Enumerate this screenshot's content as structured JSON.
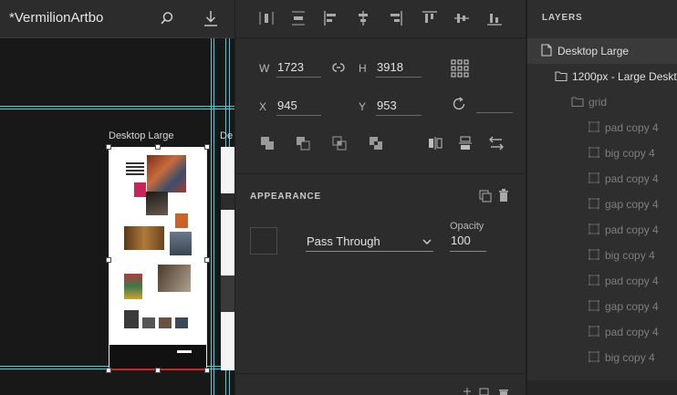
{
  "document": {
    "title": "*VermilionArtbo"
  },
  "canvas": {
    "artboard_label": "Desktop Large",
    "artboard_label_2": "De"
  },
  "transform": {
    "w_label": "W",
    "w_value": "1723",
    "h_label": "H",
    "h_value": "3918",
    "x_label": "X",
    "x_value": "945",
    "y_label": "Y",
    "y_value": "953",
    "rotation_value": ""
  },
  "appearance": {
    "title": "APPEARANCE",
    "blend_mode": "Pass Through",
    "opacity_label": "Opacity",
    "opacity_value": "100"
  },
  "layers": {
    "title": "LAYERS",
    "items": [
      {
        "label": "Desktop Large",
        "depth": 0,
        "kind": "artboard",
        "selected": true
      },
      {
        "label": "1200px - Large Desktop",
        "depth": 1,
        "kind": "group"
      },
      {
        "label": "grid",
        "depth": 2,
        "kind": "group",
        "dim": true
      },
      {
        "label": "pad copy 4",
        "depth": 3,
        "kind": "rect",
        "dim": true
      },
      {
        "label": "big copy 4",
        "depth": 3,
        "kind": "rect",
        "dim": true
      },
      {
        "label": "pad copy 4",
        "depth": 3,
        "kind": "rect",
        "dim": true
      },
      {
        "label": "gap copy 4",
        "depth": 3,
        "kind": "rect",
        "dim": true
      },
      {
        "label": "pad copy 4",
        "depth": 3,
        "kind": "rect",
        "dim": true
      },
      {
        "label": "big copy 4",
        "depth": 3,
        "kind": "rect",
        "dim": true
      },
      {
        "label": "pad copy 4",
        "depth": 3,
        "kind": "rect",
        "dim": true
      },
      {
        "label": "gap copy 4",
        "depth": 3,
        "kind": "rect",
        "dim": true
      },
      {
        "label": "pad copy 4",
        "depth": 3,
        "kind": "rect",
        "dim": true
      },
      {
        "label": "big copy 4",
        "depth": 3,
        "kind": "rect",
        "dim": true
      }
    ]
  },
  "colors": {
    "guide": "#3fd3e0",
    "selection": "#3a3a3a",
    "accent_red": "#c9252c"
  }
}
